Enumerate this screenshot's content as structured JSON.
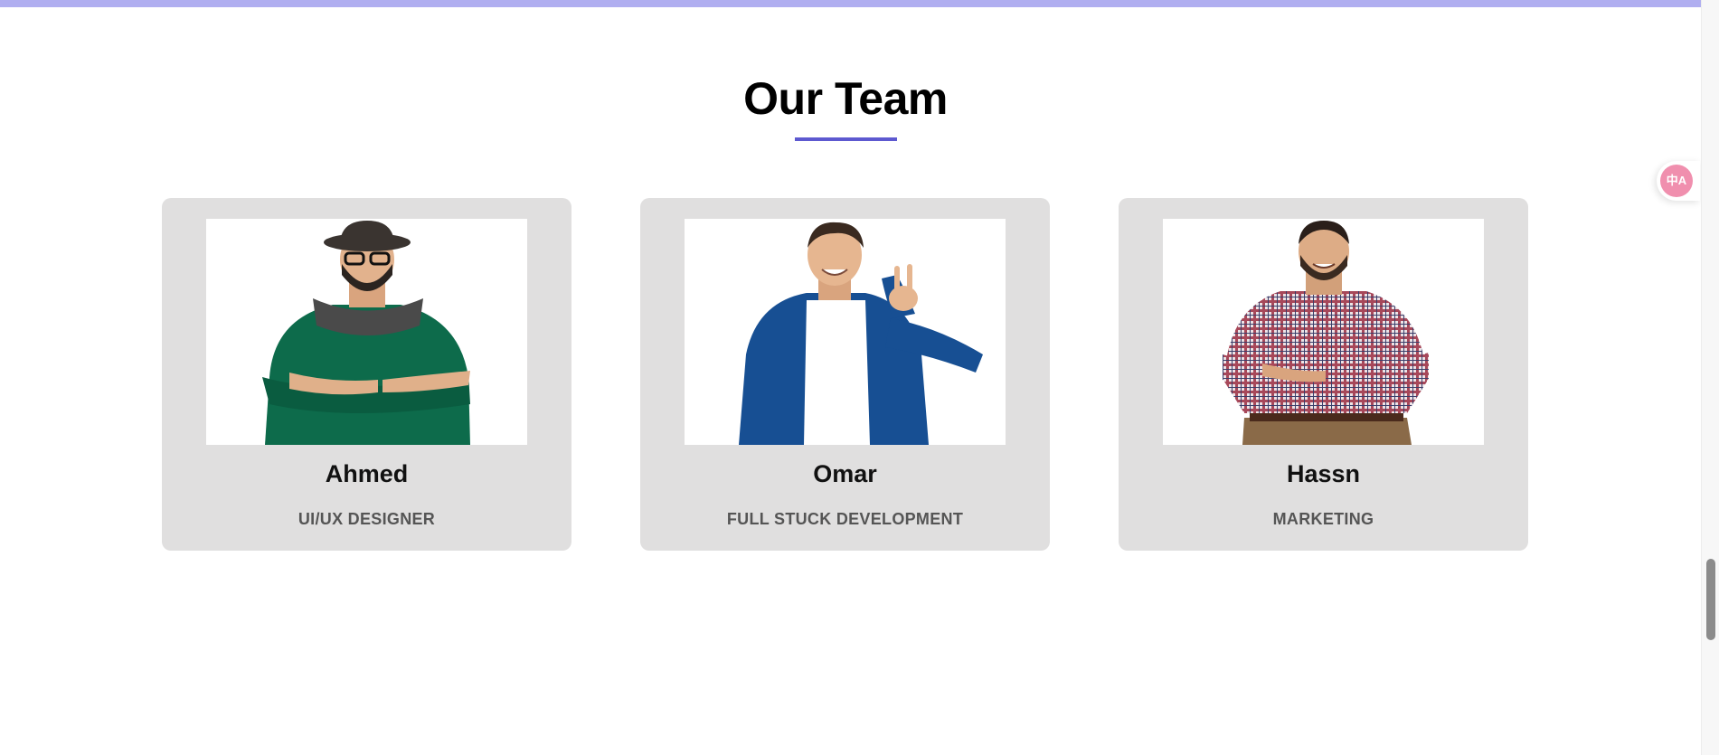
{
  "section": {
    "title": "Our Team"
  },
  "team": [
    {
      "name": "Ahmed",
      "role": "UI/UX DESIGNER",
      "photo_icon": "person-green-sweater-hat"
    },
    {
      "name": "Omar",
      "role": "FULL STUCK DEVELOPMENT",
      "photo_icon": "person-blue-jacket-peace-sign"
    },
    {
      "name": "Hassn",
      "role": "MARKETING",
      "photo_icon": "person-plaid-shirt"
    }
  ],
  "colors": {
    "accent": "#5d59d0",
    "top_bar": "#b0aef0",
    "card_bg": "#e0dfdf",
    "translate_widget": "#f08fae"
  },
  "widgets": {
    "translate_icon": "translate-icon",
    "translate_glyph": "中A"
  }
}
